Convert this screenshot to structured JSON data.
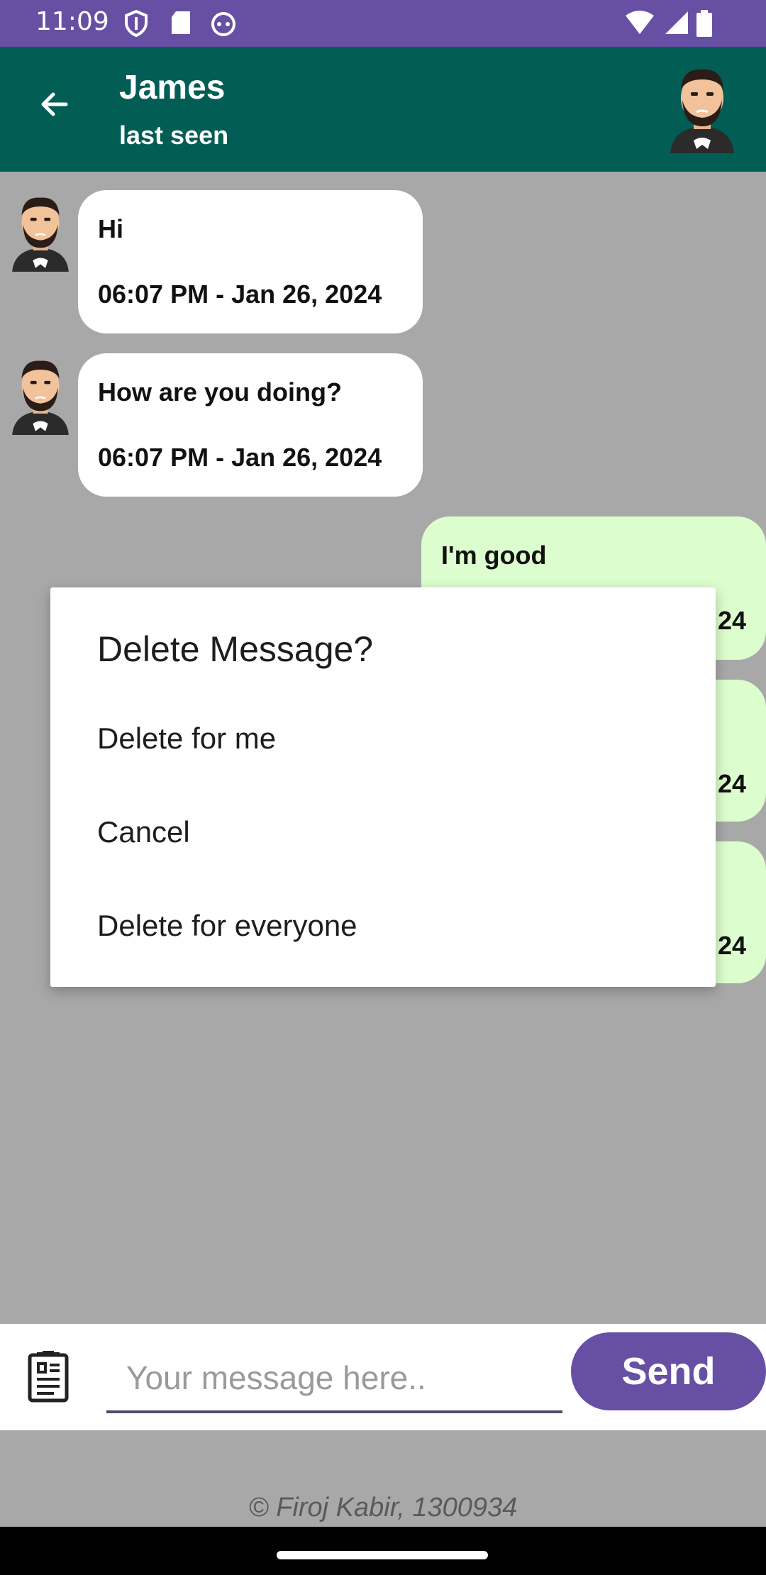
{
  "status_bar": {
    "time": "11:09",
    "icons": [
      "shield-icon",
      "sd-card-icon",
      "cat-face-icon",
      "wifi-icon",
      "signal-icon",
      "battery-icon"
    ]
  },
  "header": {
    "back_icon": "arrow-left-icon",
    "name": "James",
    "subtitle": "last seen",
    "avatar": "bearded-man-avatar"
  },
  "messages": [
    {
      "direction": "in",
      "text": "Hi",
      "time": "06:07 PM - Jan 26, 2024"
    },
    {
      "direction": "in",
      "text": "How are you doing?",
      "time": "06:07 PM - Jan 26, 2024"
    },
    {
      "direction": "out",
      "text": "I'm good",
      "time": "24"
    },
    {
      "direction": "out",
      "text": "",
      "time": "24"
    },
    {
      "direction": "out",
      "text": "",
      "time": "24"
    }
  ],
  "dialog": {
    "title": "Delete Message?",
    "options": [
      "Delete for me",
      "Cancel",
      "Delete for everyone"
    ]
  },
  "composer": {
    "attach_icon": "document-icon",
    "placeholder": "Your message here..",
    "send_label": "Send"
  },
  "footer": {
    "copyright": "© Firoj Kabir, 1300934"
  },
  "colors": {
    "status_bar": "#6750a4",
    "app_bar": "#025e54",
    "chat_bg": "#a8a8a8",
    "incoming_bubble": "#ffffff",
    "outgoing_bubble": "#dcfdcd",
    "send_button": "#6750a4"
  }
}
